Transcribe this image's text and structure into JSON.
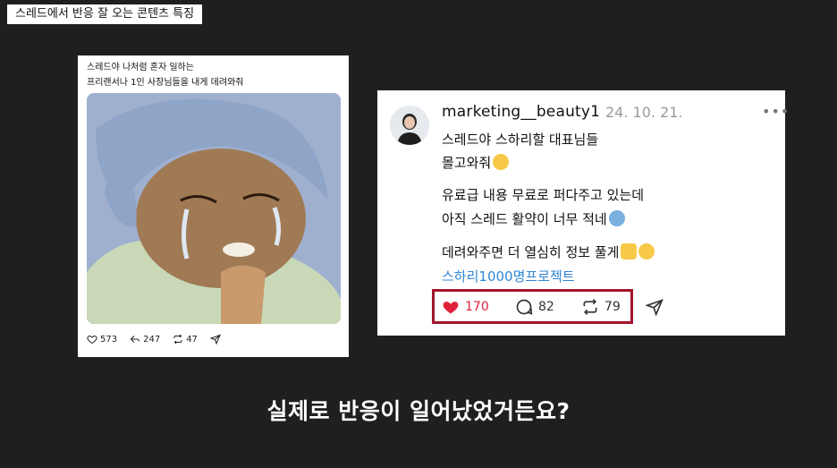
{
  "header": {
    "title": "스레드에서 반응 잘 오는 콘텐츠 특징"
  },
  "left_post": {
    "text_line1": "스레드야 나처럼 혼자 일하는",
    "text_line2": "프리랜서나 1인 사장님들을 내게 데려와줘",
    "image_icon": "crying-grandma-illustration",
    "stats": {
      "likes": "573",
      "replies": "247",
      "reposts": "47"
    }
  },
  "right_post": {
    "username": "marketing__beauty1",
    "date": "24. 10. 21.",
    "more": "•••",
    "line1": "스레드야 스하리할 대표님들",
    "line2": "몰고와줘",
    "line3": "유료급 내용 무료로 퍼다주고 있는데",
    "line4": "아직 스레드 활약이 너무 적네",
    "line5": "데려와주면 더 열심히 정보 풀게",
    "hashtag": "스하리1000명프로젝트",
    "stats": {
      "likes": "170",
      "replies": "82",
      "reposts": "79"
    },
    "highlight_color": "#a3142c",
    "like_color": "#e0213a",
    "hashtag_color": "#2e86d6"
  },
  "caption": {
    "text": "실제로 반응이 일어났었거든요?"
  }
}
